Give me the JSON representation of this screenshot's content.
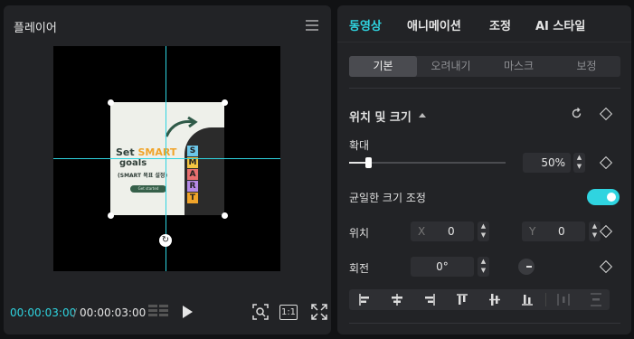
{
  "player": {
    "title": "플레이어",
    "poster": {
      "title_prefix": "Set ",
      "title_highlight": "SMART",
      "title_line2": "goals",
      "subtitle": "(SMART 목표 설정)",
      "button": "Get started",
      "letters": [
        "S",
        "M",
        "A",
        "R",
        "T"
      ],
      "letter_colors": [
        "#6cc7e8",
        "#f4c542",
        "#e86f6f",
        "#b58ae6",
        "#f0a42a"
      ]
    },
    "current_time": "00:00:03:00",
    "separator": "/",
    "total_time": "00:00:03:00",
    "ratio_label": "1:1"
  },
  "props": {
    "tabs": [
      "동영상",
      "애니메이션",
      "조정",
      "AI 스타일"
    ],
    "active_tab_color": "#2fd4e0",
    "subtabs": [
      "기본",
      "오려내기",
      "마스크",
      "보정"
    ],
    "section_title": "위치 및 크기",
    "scale_label": "확대",
    "scale_value": "50%",
    "scale_fraction": 0.12,
    "uniform_scale_label": "균일한 크기 조정",
    "uniform_scale_on": true,
    "position_label": "위치",
    "x_label": "X",
    "x_value": "0",
    "y_label": "Y",
    "y_value": "0",
    "rotation_label": "회전",
    "rotation_value": "0°"
  }
}
